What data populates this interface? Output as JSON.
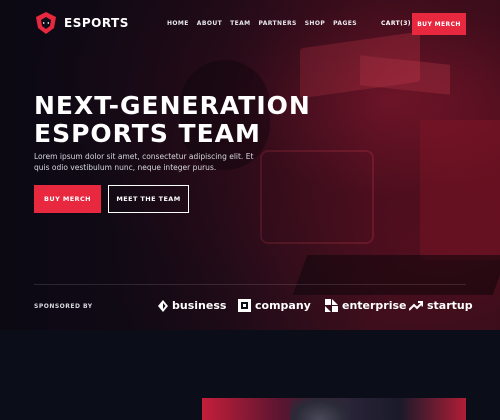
{
  "nav": {
    "brand": "ESPORTS",
    "items": [
      "HOME",
      "ABOUT",
      "TEAM",
      "PARTNERS",
      "SHOP",
      "PAGES"
    ],
    "cart": "CART(3)",
    "cta": "BUY MERCH"
  },
  "hero": {
    "title_line1": "NEXT-GENERATION",
    "title_line2": "ESPORTS TEAM",
    "subtitle": "Lorem ipsum dolor sit amet, consectetur adipiscing elit. Et quis odio vestibulum nunc, neque integer purus.",
    "primary_button": "BUY MERCH",
    "secondary_button": "MEET THE TEAM"
  },
  "sponsors": {
    "label": "SPONSORED BY",
    "items": [
      {
        "name": "business",
        "icon": "diamond-icon"
      },
      {
        "name": "company",
        "icon": "square-logo-icon"
      },
      {
        "name": "enterprise",
        "icon": "grid-logo-icon"
      },
      {
        "name": "startup",
        "icon": "trend-arrow-icon"
      }
    ]
  },
  "colors": {
    "accent": "#e8283f",
    "background": "#0b0d18"
  }
}
